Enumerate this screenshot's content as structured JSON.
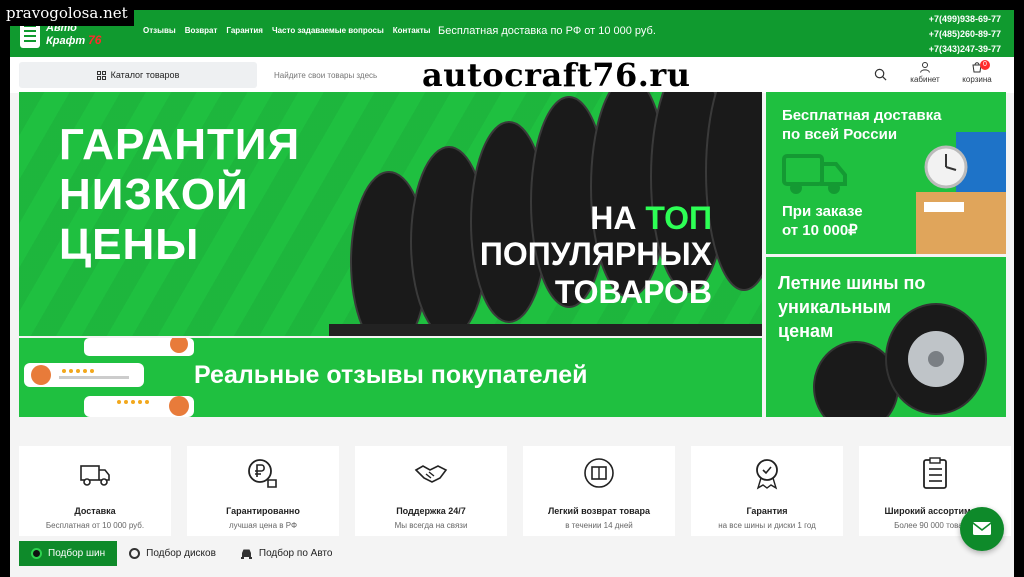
{
  "watermark": "pravogolosa.net",
  "header": {
    "logo_line1": "Авто",
    "logo_line2": "Крафт",
    "logo_num": "76",
    "nav": [
      "Отзывы",
      "Возврат",
      "Гарантия",
      "Часто задаваемые вопросы",
      "Контакты"
    ],
    "promo": "Бесплатная доставка по РФ от 10 000 руб.",
    "phones": [
      "+7(499)938-69-77",
      "+7(485)260-89-77",
      "+7(343)247-39-77"
    ]
  },
  "search": {
    "catalog_label": "Каталог товаров",
    "placeholder": "Найдите свои товары здесь",
    "cabinet_label": "кабинет",
    "cart_label": "корзина",
    "cart_count": "0"
  },
  "overlay_text": "autocraft76.ru",
  "banners": {
    "main_line1": "ГАРАНТИЯ",
    "main_line2": "НИЗКОЙ",
    "main_line3": "ЦЕНЫ",
    "top_prefix": "НА ",
    "top_accent": "ТОП",
    "popular_line1": "ПОПУЛЯРНЫХ",
    "popular_line2": "ТОВАРОВ",
    "reviews": "Реальные отзывы покупателей",
    "delivery_line1": "Бесплатная доставка",
    "delivery_line2": "по всей России",
    "order_line1": "При заказе",
    "order_line2": "от 10 000₽",
    "summer_line1": "Летние шины по",
    "summer_line2": "уникальным",
    "summer_line3": "ценам"
  },
  "features": [
    {
      "icon": "delivery-truck-icon",
      "title": "Доставка",
      "sub": "Бесплатная от 10 000 руб."
    },
    {
      "icon": "ruble-thumbs-up-icon",
      "title": "Гарантированно",
      "sub": "лучшая цена в РФ"
    },
    {
      "icon": "handshake-icon",
      "title": "Поддержка 24/7",
      "sub": "Мы всегда на связи"
    },
    {
      "icon": "box-return-icon",
      "title": "Легкий возврат товара",
      "sub": "в течении 14 дней"
    },
    {
      "icon": "medal-icon",
      "title": "Гарантия",
      "sub": "на все шины и диски 1 год"
    },
    {
      "icon": "clipboard-list-icon",
      "title": "Широкий ассортимент",
      "sub": "Более 90 000 товаров"
    }
  ],
  "tabs": [
    {
      "label": "Подбор шин",
      "icon": "tire-icon"
    },
    {
      "label": "Подбор дисков",
      "icon": "wheel-rim-icon"
    },
    {
      "label": "Подбор по Авто",
      "icon": "car-icon"
    }
  ],
  "colors": {
    "brand_green": "#109a2f",
    "banner_green": "#1fc040",
    "accent_red": "#ff2b2b",
    "dark_green": "#0e8a2a"
  }
}
